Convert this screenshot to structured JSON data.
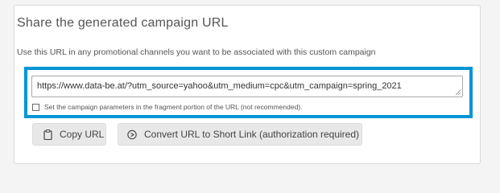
{
  "section": {
    "title": "Share the generated campaign URL",
    "description": "Use this URL in any promotional channels you want to be associated with this custom campaign"
  },
  "url_field": {
    "value": "https://www.data-be.at/?utm_source=yahoo&utm_medium=cpc&utm_campaign=spring_2021"
  },
  "fragment_option": {
    "label": "Set the campaign parameters in the fragment portion of the URL (not recommended).",
    "checked": false
  },
  "buttons": {
    "copy_label": "Copy URL",
    "short_link_label": "Convert URL to Short Link (authorization required)"
  },
  "colors": {
    "highlight_border": "#0096d6",
    "button_background": "#e8e8e8"
  },
  "icons": {
    "copy": "clipboard-icon",
    "short_link": "link-circle-icon"
  }
}
